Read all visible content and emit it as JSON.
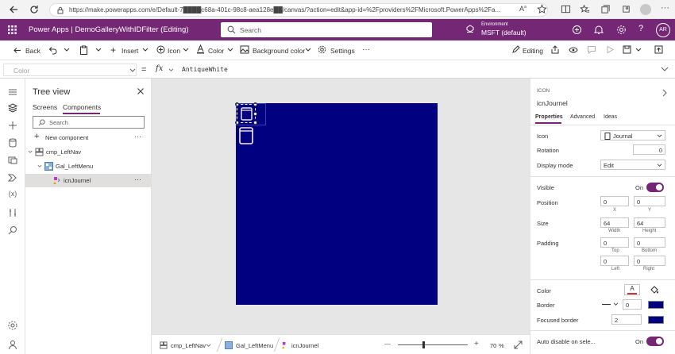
{
  "browser": {
    "url": "https://make.powerapps.com/e/Default-7████c68a-401c-98c8-aea128e██/canvas/?action=edit&app-id=%2Fproviders%2FMicrosoft.PowerApps%2Fa..."
  },
  "header": {
    "app_title": "Power Apps  |  DemoGalleryWithIDFilter (Editing)",
    "search_placeholder": "Search",
    "env_label": "Environment",
    "env_name": "MSFT (default)",
    "avatar_initials": "AR"
  },
  "commandbar": {
    "back": "Back",
    "insert": "Insert",
    "icon": "Icon",
    "color": "Color",
    "background_color": "Background color",
    "settings": "Settings",
    "more": "···",
    "editing": "Editing"
  },
  "formula": {
    "property": "Color",
    "equals": "=",
    "fx": "fx",
    "value": "AntiqueWhite"
  },
  "tree": {
    "title": "Tree view",
    "tabs": [
      "Screens",
      "Components"
    ],
    "active_tab": "Components",
    "search_placeholder": "Search",
    "new_component": "New component",
    "more": "···",
    "items": [
      {
        "label": "cmp_LeftNav"
      },
      {
        "label": "Gal_LeftMenu"
      },
      {
        "label": "icnJournel"
      }
    ]
  },
  "statusbar": {
    "crumb1": "cmp_LeftNav",
    "crumb2": "Gal_LeftMenu",
    "crumb3": "icnJournel",
    "zoom_minus": "—",
    "zoom_plus": "+",
    "zoom_value": "70",
    "zoom_unit": "%",
    "zoom_level": 0.7
  },
  "props": {
    "type": "ICON",
    "name": "icnJournel",
    "tabs": [
      "Properties",
      "Advanced",
      "Ideas"
    ],
    "active_tab": "Properties",
    "icon_label": "Icon",
    "icon_value": "Journal",
    "rotation_label": "Rotation",
    "rotation_value": "0",
    "display_mode_label": "Display mode",
    "display_mode_value": "Edit",
    "visible_label": "Visible",
    "visible_value": "On",
    "position_label": "Position",
    "position_x": "0",
    "position_y": "0",
    "x_label": "X",
    "y_label": "Y",
    "size_label": "Size",
    "width_value": "64",
    "height_value": "64",
    "width_label": "Width",
    "height_label": "Height",
    "padding_label": "Padding",
    "pad_top": "0",
    "pad_bottom": "0",
    "pad_left": "0",
    "pad_right": "0",
    "top_label": "Top",
    "bottom_label": "Bottom",
    "left_label": "Left",
    "right_label": "Right",
    "color_label": "Color",
    "color_a": "A",
    "border_label": "Border",
    "border_value": "0",
    "focused_border_label": "Focused border",
    "focused_border_value": "2",
    "auto_disable_label": "Auto disable on sele...",
    "auto_disable_value": "On"
  },
  "colors": {
    "brand": "#742774",
    "screen_fill": "#000080",
    "canvas_bg": "#e6e6e6"
  }
}
